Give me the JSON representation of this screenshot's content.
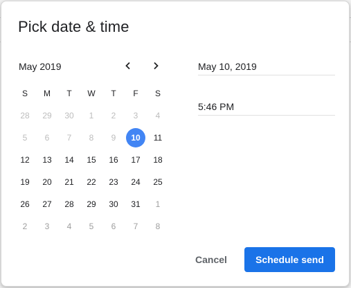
{
  "dialog": {
    "title": "Pick date & time"
  },
  "calendar": {
    "month_label": "May 2019",
    "weekdays": [
      "S",
      "M",
      "T",
      "W",
      "T",
      "F",
      "S"
    ],
    "weeks": [
      [
        {
          "d": "28",
          "s": "out"
        },
        {
          "d": "29",
          "s": "out"
        },
        {
          "d": "30",
          "s": "out"
        },
        {
          "d": "1",
          "s": "out"
        },
        {
          "d": "2",
          "s": "out"
        },
        {
          "d": "3",
          "s": "out"
        },
        {
          "d": "4",
          "s": "out"
        }
      ],
      [
        {
          "d": "5",
          "s": "out"
        },
        {
          "d": "6",
          "s": "out"
        },
        {
          "d": "7",
          "s": "out"
        },
        {
          "d": "8",
          "s": "out"
        },
        {
          "d": "9",
          "s": "out"
        },
        {
          "d": "10",
          "s": "sel"
        },
        {
          "d": "11",
          "s": "in"
        }
      ],
      [
        {
          "d": "12",
          "s": "in"
        },
        {
          "d": "13",
          "s": "in"
        },
        {
          "d": "14",
          "s": "in"
        },
        {
          "d": "15",
          "s": "in"
        },
        {
          "d": "16",
          "s": "in"
        },
        {
          "d": "17",
          "s": "in"
        },
        {
          "d": "18",
          "s": "in"
        }
      ],
      [
        {
          "d": "19",
          "s": "in"
        },
        {
          "d": "20",
          "s": "in"
        },
        {
          "d": "21",
          "s": "in"
        },
        {
          "d": "22",
          "s": "in"
        },
        {
          "d": "23",
          "s": "in"
        },
        {
          "d": "24",
          "s": "in"
        },
        {
          "d": "25",
          "s": "in"
        }
      ],
      [
        {
          "d": "26",
          "s": "in"
        },
        {
          "d": "27",
          "s": "in"
        },
        {
          "d": "28",
          "s": "in"
        },
        {
          "d": "29",
          "s": "in"
        },
        {
          "d": "30",
          "s": "in"
        },
        {
          "d": "31",
          "s": "in"
        },
        {
          "d": "1",
          "s": "next"
        }
      ],
      [
        {
          "d": "2",
          "s": "next"
        },
        {
          "d": "3",
          "s": "next"
        },
        {
          "d": "4",
          "s": "next"
        },
        {
          "d": "5",
          "s": "next"
        },
        {
          "d": "6",
          "s": "next"
        },
        {
          "d": "7",
          "s": "next"
        },
        {
          "d": "8",
          "s": "next"
        }
      ]
    ]
  },
  "fields": {
    "date_value": "May 10, 2019",
    "time_value": "5:46 PM"
  },
  "actions": {
    "cancel_label": "Cancel",
    "schedule_label": "Schedule send"
  },
  "colors": {
    "accent": "#1a73e8",
    "selected_day": "#4285f4",
    "muted_day": "#bdbdbd"
  },
  "icons": {
    "prev": "chevron-left-icon",
    "next": "chevron-right-icon"
  }
}
